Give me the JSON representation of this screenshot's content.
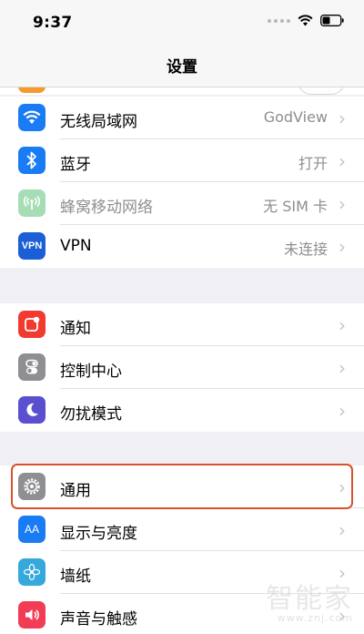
{
  "status": {
    "time": "9:37"
  },
  "nav": {
    "title": "设置"
  },
  "network": [
    {
      "label": "无线局域网",
      "value": "GodView",
      "icon": "wifi-icon",
      "color": "#1a7cf5"
    },
    {
      "label": "蓝牙",
      "value": "打开",
      "icon": "bluetooth-icon",
      "color": "#1a7cf5"
    },
    {
      "label": "蜂窝移动网络",
      "value": "无 SIM 卡",
      "icon": "cellular-antenna-icon",
      "color": "#a6ddb4",
      "disabled": true
    },
    {
      "label": "VPN",
      "value": "未连接",
      "icon": "vpn-icon",
      "color": "#1a5fd6",
      "icon_text": "VPN"
    }
  ],
  "alerts": [
    {
      "label": "通知",
      "icon": "notification-icon",
      "color": "#f23b30"
    },
    {
      "label": "控制中心",
      "icon": "control-center-icon",
      "color": "#8e8e93"
    },
    {
      "label": "勿扰模式",
      "icon": "moon-icon",
      "color": "#5a4fcf"
    }
  ],
  "system": [
    {
      "label": "通用",
      "icon": "gear-icon",
      "color": "#8e8e93"
    },
    {
      "label": "显示与亮度",
      "icon": "display-brightness-icon",
      "color": "#1a7cf5",
      "icon_text": "AA"
    },
    {
      "label": "墙纸",
      "icon": "wallpaper-flower-icon",
      "color": "#35a8dc"
    },
    {
      "label": "声音与触感",
      "icon": "speaker-icon",
      "color": "#f23b55"
    }
  ],
  "chevron": "›",
  "watermark": {
    "logo": "智能家",
    "url": "www.znj.com"
  }
}
